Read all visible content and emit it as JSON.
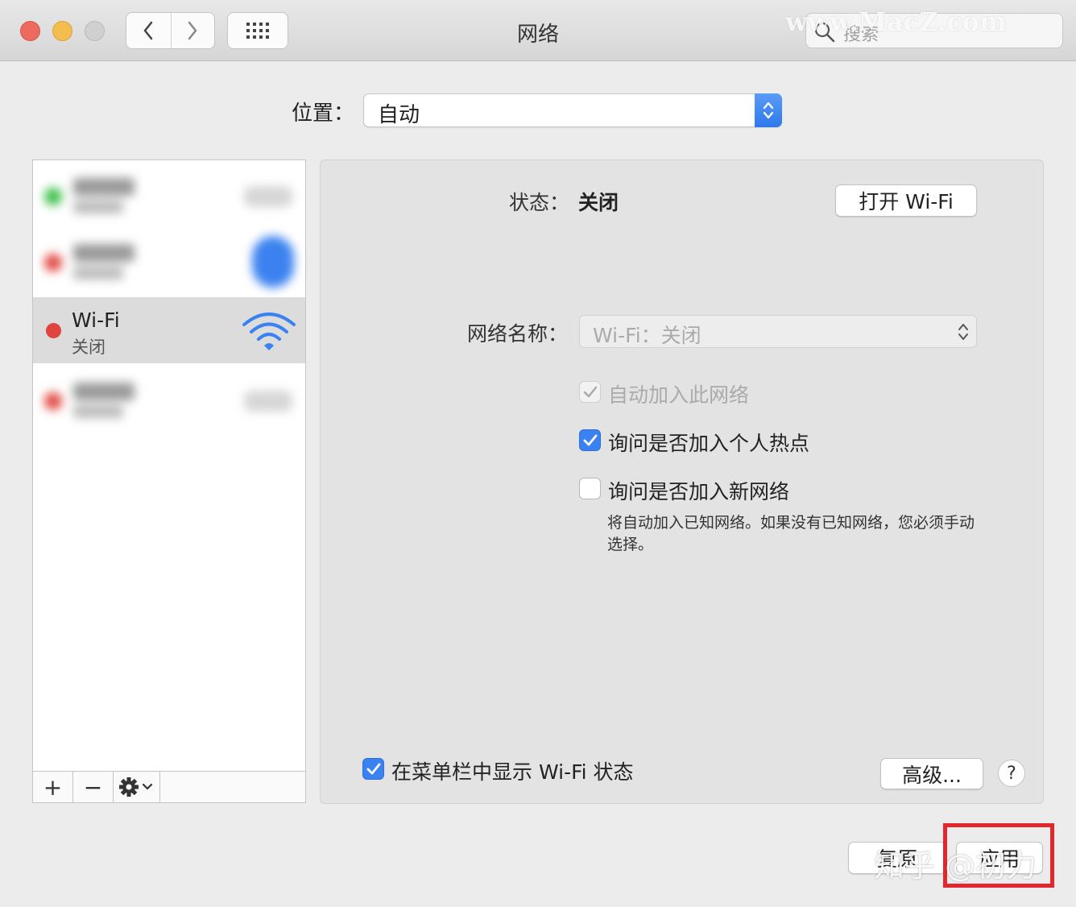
{
  "window": {
    "title": "网络",
    "search_placeholder": "搜索",
    "watermark": "www.MacZ.com"
  },
  "location": {
    "label": "位置：",
    "value": "自动"
  },
  "sidebar": {
    "selected": {
      "name": "Wi-Fi",
      "status": "关闭",
      "status_color": "#e0443f"
    },
    "tools": [
      "+",
      "−"
    ]
  },
  "panel": {
    "status_label": "状态：",
    "status_value": "关闭",
    "turn_on_button": "打开 Wi-Fi",
    "network_name_label": "网络名称：",
    "network_name_value": "Wi-Fi：关闭",
    "auto_join_label": "自动加入此网络",
    "ask_hotspot_label": "询问是否加入个人热点",
    "ask_new_label": "询问是否加入新网络",
    "hint": "将自动加入已知网络。如果没有已知网络，您必须手动选择。",
    "show_menubar_label": "在菜单栏中显示 Wi-Fi 状态",
    "advanced_button": "高级...",
    "help_button": "?"
  },
  "footer": {
    "revert_button": "复原",
    "apply_button": "应用",
    "watermark": "知乎 @初力"
  },
  "colors": {
    "accent": "#3a82f2",
    "highlight": "#e2262b"
  }
}
